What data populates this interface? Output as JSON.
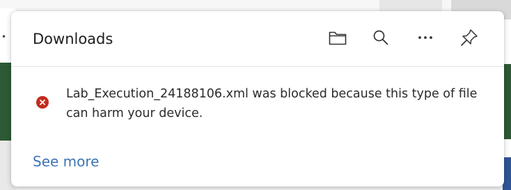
{
  "downloads_panel": {
    "title": "Downloads",
    "toolbar": {
      "open_folder_icon": "folder-icon",
      "search_icon": "search-icon",
      "more_options_icon": "more-options-icon",
      "pin_icon": "pin-icon"
    },
    "item": {
      "status_icon": "error-icon",
      "message": "Lab_Execution_24188106.xml was blocked because this type of file can harm your device."
    },
    "see_more_label": "See more"
  },
  "colors": {
    "error_red": "#c42b1c",
    "link_blue": "#3d74b5",
    "background_green": "#2d5a34",
    "background_blue": "#2f5597"
  }
}
